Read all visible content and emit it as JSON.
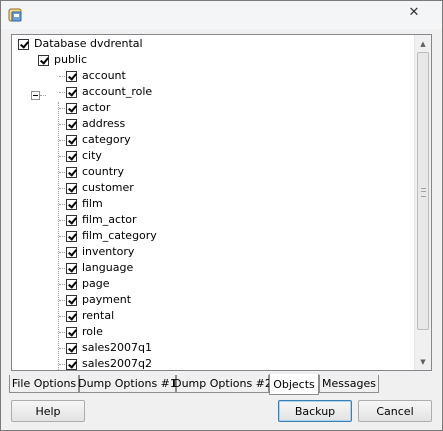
{
  "window": {
    "close_glyph": "✕"
  },
  "tree": {
    "root": "Database dvdrental",
    "schema": "public",
    "items": [
      "account",
      "account_role",
      "actor",
      "address",
      "category",
      "city",
      "country",
      "customer",
      "film",
      "film_actor",
      "film_category",
      "inventory",
      "language",
      "page",
      "payment",
      "rental",
      "role",
      "sales2007q1",
      "sales2007q2"
    ]
  },
  "tabs": [
    {
      "label": "File Options",
      "active": false
    },
    {
      "label": "Dump Options #1",
      "active": false
    },
    {
      "label": "Dump Options #2",
      "active": false
    },
    {
      "label": "Objects",
      "active": true
    },
    {
      "label": "Messages",
      "active": false
    }
  ],
  "buttons": {
    "help": "Help",
    "backup": "Backup",
    "cancel": "Cancel"
  },
  "icons": {
    "app": "backup-app-icon",
    "close": "close-icon",
    "scroll_up": "scroll-up-arrow-icon",
    "scroll_down": "scroll-down-arrow-icon",
    "expander": "tree-collapse-icon"
  },
  "colors": {
    "window_bg": "#f0f0f0",
    "default_button_border": "#3c7fb1"
  }
}
